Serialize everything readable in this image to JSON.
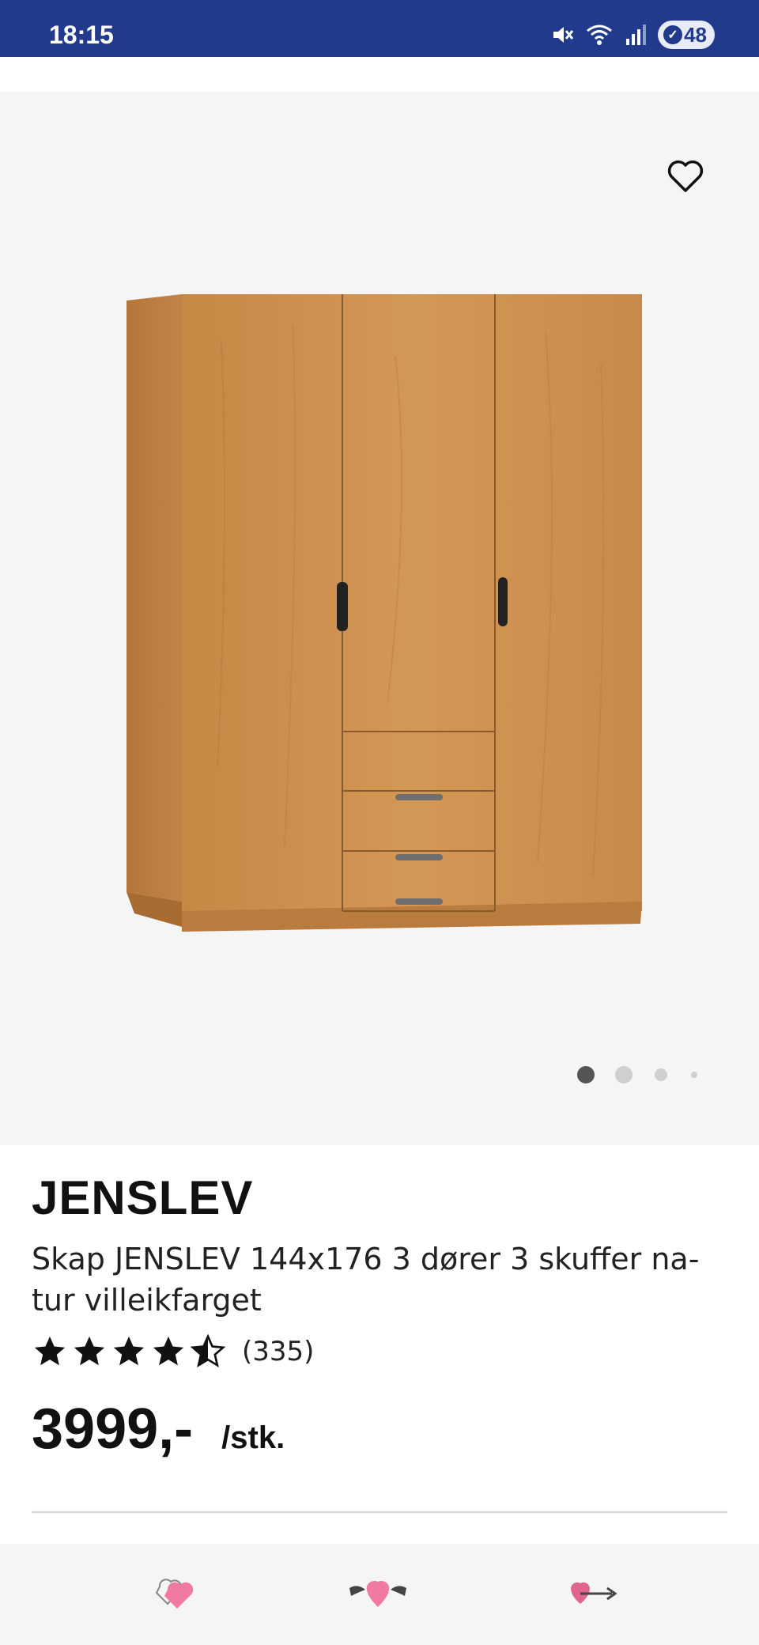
{
  "status_bar": {
    "time": "18:15",
    "battery": "48",
    "icons": [
      "mute-icon",
      "wifi-icon",
      "signal-icon",
      "battery-icon"
    ]
  },
  "product": {
    "brand": "JENSLEV",
    "title": "Skap JENSLEV 144x176 3 dører 3 skuffer na-tur villeikfarget",
    "rating": 4.5,
    "rating_max": 5,
    "review_count": "(335)",
    "price": "3999,-",
    "price_unit": "/stk."
  },
  "carousel": {
    "total": 4,
    "active_index": 0
  },
  "bottom_nav": {
    "icons": [
      "heart-sketch-icon",
      "winged-heart-icon",
      "heart-arrow-icon"
    ]
  },
  "colors": {
    "status_bar": "#223a8c",
    "image_background": "#f5f5f5",
    "wood": "#c98a4b"
  }
}
